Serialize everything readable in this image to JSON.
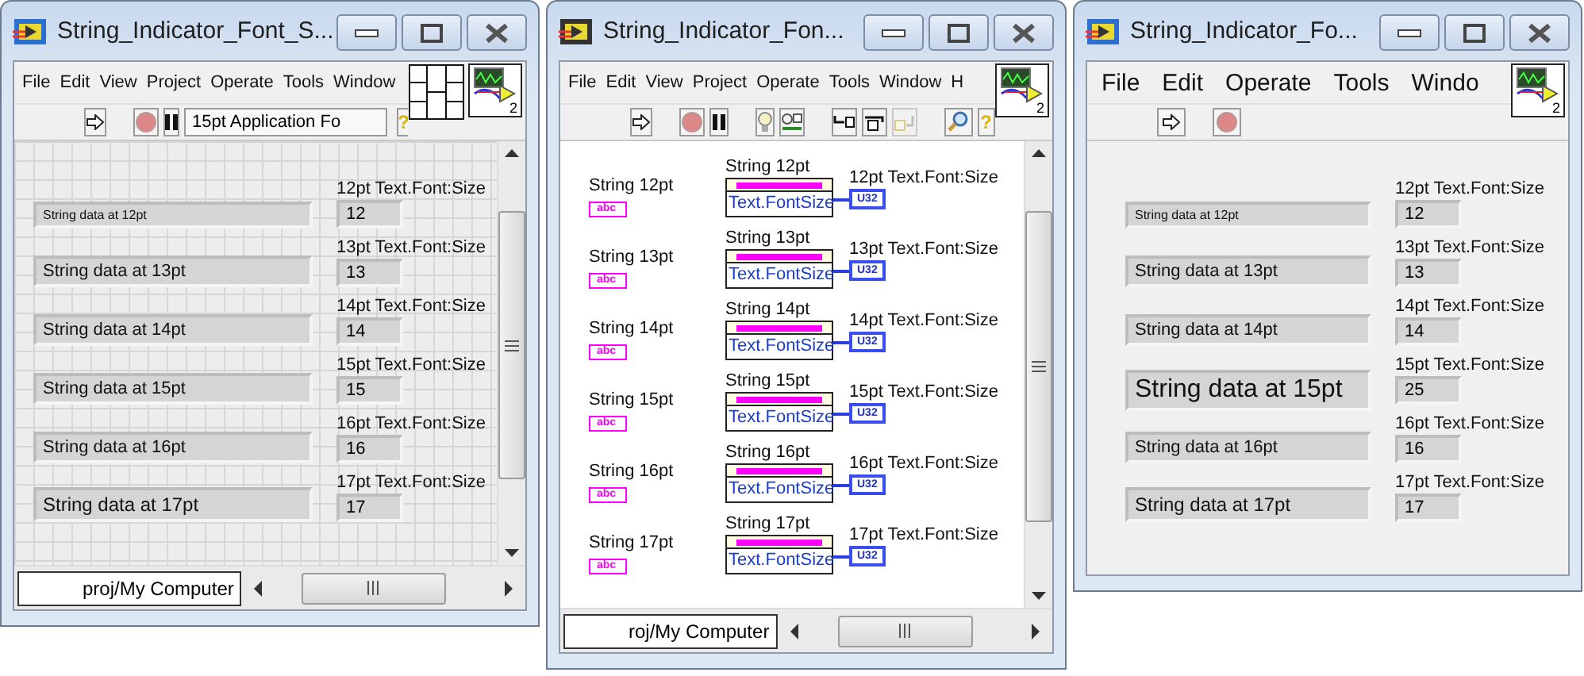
{
  "windows": [
    {
      "kind": "front_panel",
      "title": "String_Indicator_Font_S...",
      "menu": [
        "File",
        "Edit",
        "View",
        "Project",
        "Operate",
        "Tools",
        "Window"
      ],
      "connector_pane": true,
      "vi_icon_number": "2",
      "grid": true,
      "scrollbars": true,
      "status_path": "proj/My Computer",
      "toolbar": [
        {
          "kind": "run",
          "disabled": false
        },
        {
          "kind": "abort",
          "disabled": false
        },
        {
          "kind": "pause",
          "disabled": false
        },
        {
          "kind": "font",
          "label": "15pt Application Fo",
          "disabled": false
        },
        {
          "kind": "help",
          "label": "?",
          "disabled": false
        }
      ],
      "rows": [
        {
          "string": "String data at 12pt",
          "size_label": "12pt Text.Font:Size",
          "size_value": "12"
        },
        {
          "string": "String data at 13pt",
          "size_label": "13pt Text.Font:Size",
          "size_value": "13"
        },
        {
          "string": "String data at 14pt",
          "size_label": "14pt Text.Font:Size",
          "size_value": "14"
        },
        {
          "string": "String data at 15pt",
          "size_label": "15pt Text.Font:Size",
          "size_value": "15"
        },
        {
          "string": "String data at 16pt",
          "size_label": "16pt Text.Font:Size",
          "size_value": "16"
        },
        {
          "string": "String data at 17pt",
          "size_label": "17pt Text.Font:Size",
          "size_value": "17"
        }
      ]
    },
    {
      "kind": "block_diagram",
      "title": "String_Indicator_Fon...",
      "menu": [
        "File",
        "Edit",
        "View",
        "Project",
        "Operate",
        "Tools",
        "Window",
        "H"
      ],
      "connector_pane": false,
      "vi_icon_number": "2",
      "grid": false,
      "scrollbars": true,
      "status_path": "roj/My Computer",
      "toolbar": [
        {
          "kind": "run",
          "disabled": false
        },
        {
          "kind": "abort",
          "disabled": false
        },
        {
          "kind": "pause",
          "disabled": false
        },
        {
          "kind": "highlight",
          "disabled": false
        },
        {
          "kind": "retain",
          "disabled": false
        },
        {
          "kind": "step_into",
          "disabled": false
        },
        {
          "kind": "step_over",
          "disabled": false
        },
        {
          "kind": "step_out",
          "disabled": true
        },
        {
          "kind": "search",
          "disabled": false
        },
        {
          "kind": "help",
          "label": "?",
          "disabled": false
        }
      ],
      "rows": [
        {
          "control_label": "String 12pt",
          "terminal_text": "abc",
          "node_label": "String 12pt",
          "property": "Text.FontSize",
          "indicator_label": "12pt Text.Font:Size",
          "indicator_text": "U32"
        },
        {
          "control_label": "String 13pt",
          "terminal_text": "abc",
          "node_label": "String 13pt",
          "property": "Text.FontSize",
          "indicator_label": "13pt Text.Font:Size",
          "indicator_text": "U32"
        },
        {
          "control_label": "String 14pt",
          "terminal_text": "abc",
          "node_label": "String 14pt",
          "property": "Text.FontSize",
          "indicator_label": "14pt Text.Font:Size",
          "indicator_text": "U32"
        },
        {
          "control_label": "String 15pt",
          "terminal_text": "abc",
          "node_label": "String 15pt",
          "property": "Text.FontSize",
          "indicator_label": "15pt Text.Font:Size",
          "indicator_text": "U32"
        },
        {
          "control_label": "String 16pt",
          "terminal_text": "abc",
          "node_label": "String 16pt",
          "property": "Text.FontSize",
          "indicator_label": "16pt Text.Font:Size",
          "indicator_text": "U32"
        },
        {
          "control_label": "String 17pt",
          "terminal_text": "abc",
          "node_label": "String 17pt",
          "property": "Text.FontSize",
          "indicator_label": "17pt Text.Font:Size",
          "indicator_text": "U32"
        }
      ]
    },
    {
      "kind": "front_panel",
      "title": "String_Indicator_Fo...",
      "menu": [
        "File",
        "Edit",
        "Operate",
        "Tools",
        "Windo"
      ],
      "connector_pane": false,
      "vi_icon_number": "2",
      "grid": false,
      "scrollbars": false,
      "toolbar": [
        {
          "kind": "run",
          "disabled": false
        },
        {
          "kind": "abort",
          "disabled": false
        }
      ],
      "rows": [
        {
          "string": "String data at 12pt",
          "size_label": "12pt Text.Font:Size",
          "size_value": "12"
        },
        {
          "string": "String data at 13pt",
          "size_label": "13pt Text.Font:Size",
          "size_value": "13"
        },
        {
          "string": "String data at 14pt",
          "size_label": "14pt Text.Font:Size",
          "size_value": "14"
        },
        {
          "string": "String data at 15pt",
          "size_label": "15pt Text.Font:Size",
          "size_value": "25"
        },
        {
          "string": "String data at 16pt",
          "size_label": "16pt Text.Font:Size",
          "size_value": "16"
        },
        {
          "string": "String data at 17pt",
          "size_label": "17pt Text.Font:Size",
          "size_value": "17"
        }
      ]
    }
  ]
}
